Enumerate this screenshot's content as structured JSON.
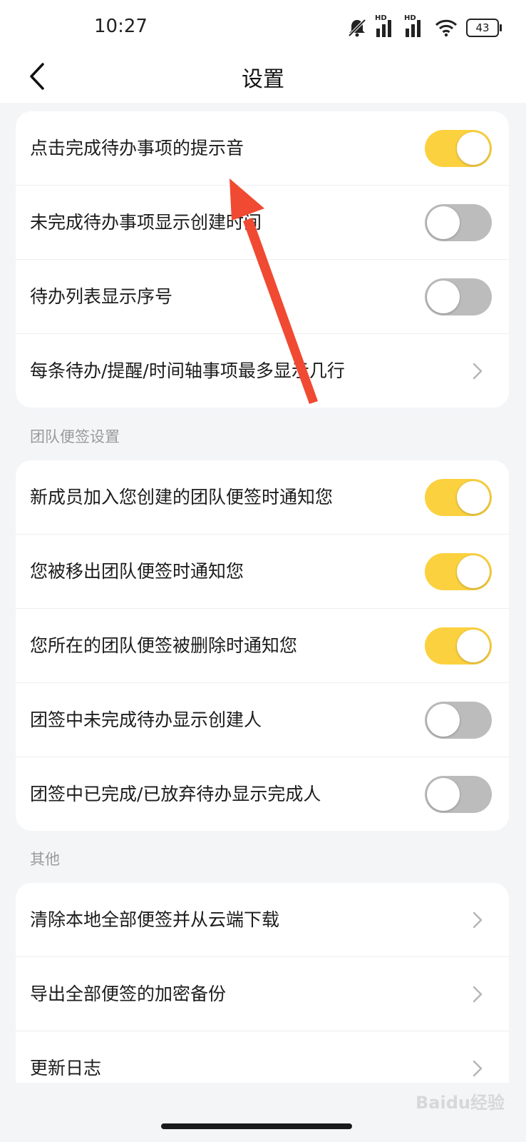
{
  "status_bar": {
    "time": "10:27",
    "battery": "43"
  },
  "header": {
    "title": "设置"
  },
  "group_todo": {
    "items": [
      {
        "label": "点击完成待办事项的提示音",
        "state": "on"
      },
      {
        "label": "未完成待办事项显示创建时间",
        "state": "off"
      },
      {
        "label": "待办列表显示序号",
        "state": "off"
      },
      {
        "label": "每条待办/提醒/时间轴事项最多显示几行"
      }
    ]
  },
  "group_team": {
    "title": "团队便签设置",
    "items": [
      {
        "label": "新成员加入您创建的团队便签时通知您",
        "state": "on"
      },
      {
        "label": "您被移出团队便签时通知您",
        "state": "on"
      },
      {
        "label": "您所在的团队便签被删除时通知您",
        "state": "on"
      },
      {
        "label": "团签中未完成待办显示创建人",
        "state": "off"
      },
      {
        "label": "团签中已完成/已放弃待办显示完成人",
        "state": "off"
      }
    ]
  },
  "group_other": {
    "title": "其他",
    "items": [
      {
        "label": "清除本地全部便签并从云端下载"
      },
      {
        "label": "导出全部便签的加密备份"
      },
      {
        "label": "更新日志"
      }
    ]
  },
  "watermark": "Baidu经验",
  "colors": {
    "toggle_on": "#fbd13f",
    "toggle_off": "#bcbcbc",
    "annotation_arrow": "#f04a32"
  }
}
